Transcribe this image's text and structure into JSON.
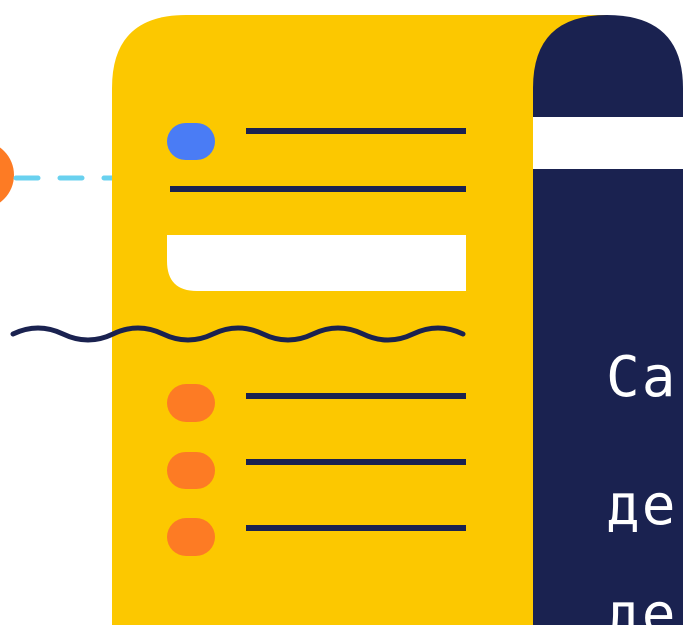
{
  "colors": {
    "background": "#ffffff",
    "document_yellow": "#fcc800",
    "navy": "#1a2250",
    "white": "#ffffff",
    "blue_dot": "#4a7cf5",
    "orange_dot": "#fd7b24",
    "dash_line": "#69d1ef"
  },
  "icons": {
    "document": "document-scroll-icon",
    "wave": "wave-line-icon",
    "connector": "dashed-connector-line"
  },
  "panel": {
    "lines": [
      "Са",
      "де",
      "де"
    ]
  }
}
